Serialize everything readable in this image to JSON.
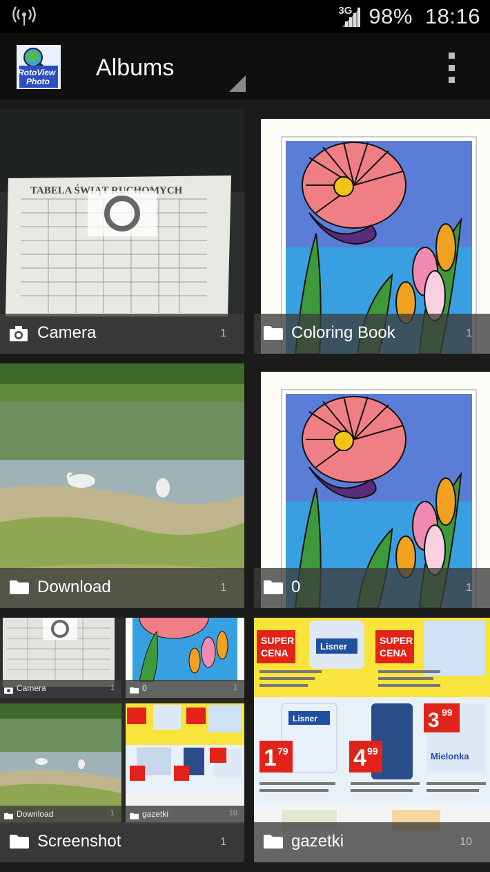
{
  "status_bar": {
    "network": "3G",
    "battery": "98%",
    "time": "18:16"
  },
  "app_bar": {
    "logo_text_line1": "RotoView",
    "logo_text_line2": "Photo",
    "title": "Albums"
  },
  "albums": [
    {
      "name": "Camera",
      "count": "1",
      "icon": "camera-icon"
    },
    {
      "name": "Coloring Book",
      "count": "1",
      "icon": "folder-icon"
    },
    {
      "name": "Download",
      "count": "1",
      "icon": "folder-icon"
    },
    {
      "name": "0",
      "count": "1",
      "icon": "folder-icon"
    },
    {
      "name": "Screenshot",
      "count": "1",
      "icon": "folder-icon"
    },
    {
      "name": "gazetki",
      "count": "10",
      "icon": "folder-icon"
    }
  ],
  "screenshot_minis": [
    {
      "name": "Camera",
      "count": "1"
    },
    {
      "name": "0",
      "count": "1"
    },
    {
      "name": "Download",
      "count": "1"
    },
    {
      "name": "gazetki",
      "count": "10"
    }
  ],
  "thumb_text": {
    "table_title": "TABELA ŚWIĄT RUCHOMYCH",
    "super": "SUPER",
    "cena": "CENA",
    "lisner": "Lisner",
    "price1": "1",
    "price1_cents": "79",
    "price2": "4",
    "price2_cents": "99",
    "price3": "3",
    "price3_cents": "99",
    "mielonka": "Mielonka"
  }
}
